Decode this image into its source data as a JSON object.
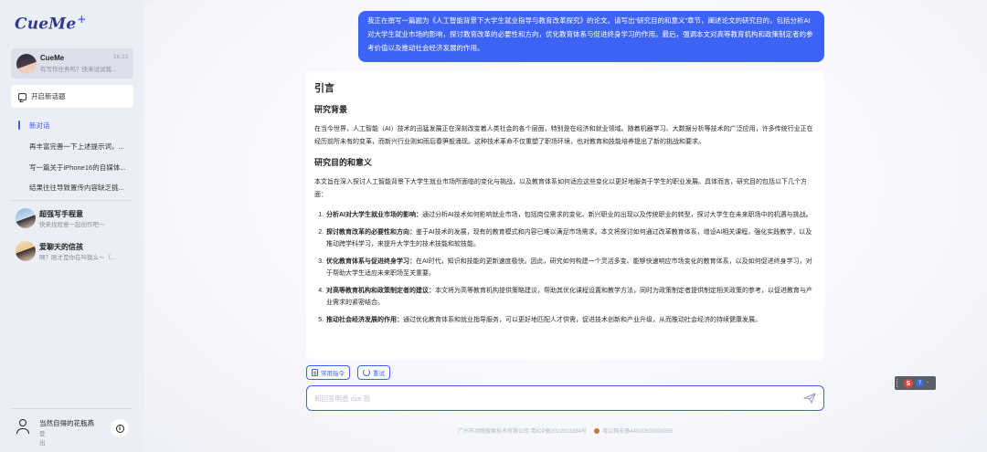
{
  "app": {
    "logo": "CueMe",
    "logo_mark": "+"
  },
  "sidebar": {
    "bot": {
      "name": "CueMe",
      "preview": "有写作任务吗？快来试试我...",
      "time": "16:22"
    },
    "new_chat_label": "开启新话题",
    "history": [
      {
        "label": "新对话",
        "active": true
      },
      {
        "label": "再丰富完善一下上述提示词，..."
      },
      {
        "label": "写一篇关于iPhone16的自媒体..."
      },
      {
        "label": "结果往往导致置传内容缺乏挑..."
      }
    ],
    "agents": [
      {
        "name": "超强写手程意",
        "preview": "快来找程意一起创作吧～"
      },
      {
        "name": "爱聊天的信孩",
        "preview": "嘀？刚才是你在叫我么～（..."
      }
    ],
    "user": {
      "name": "当然自得的花瓶燕",
      "logout": "登出"
    }
  },
  "chat": {
    "user_message": "我正在撰写一篇题为《人工智能背景下大学生就业指导与教育改革探究》的论文。请写出“研究目的和意义”章节，阐述论文的研究目的，包括分析AI对大学生就业市场的影响，探讨教育改革的必要性和方向，优化教育体系与促进终身学习的作用。最后，强调本文对高等教育机构和政策制定者的参考价值以及推动社会经济发展的作用。",
    "answer": {
      "h1": "引言",
      "h2_background": "研究背景",
      "p_background": "在当今世界，人工智能（AI）技术的迅猛发展正在深刻改变着人类社会的各个层面，特别是在经济和就业领域。随着机器学习、大数据分析等技术的广泛应用，许多传统行业正在经历前所未有的变革，而新兴行业则如雨后春笋般涌现。这种技术革命不仅重塑了职场环境，也对教育和技能培养提出了新的挑战和要求。",
      "h2_purpose": "研究目的和意义",
      "p_purpose": "本文旨在深入探讨人工智能背景下大学生就业市场所面临的变化与挑战，以及教育体系如何适应这些变化以更好地服务于学生的职业发展。具体而言，研究目的包括以下几个方面：",
      "items": [
        {
          "title": "分析AI对大学生就业市场的影响：",
          "text": "通过分析AI技术如何影响就业市场，包括岗位需求的变化、新兴职业的出现以及传统职业的转型，探讨大学生在未来职场中的机遇与挑战。"
        },
        {
          "title": "探讨教育改革的必要性和方向：",
          "text": "鉴于AI技术的发展，现有的教育模式和内容已难以满足市场需求。本文将探讨如何通过改革教育体系，增设AI相关课程，强化实践教学，以及推动跨学科学习，来提升大学生的技术技能和软技能。"
        },
        {
          "title": "优化教育体系与促进终身学习：",
          "text": "在AI时代，知识和技能的更新速度极快。因此，研究如何构建一个灵活多变、能够快速响应市场变化的教育体系，以及如何促进终身学习，对于帮助大学生适应未来职场至关重要。"
        },
        {
          "title": "对高等教育机构和政策制定者的建议：",
          "text": "本文将为高等教育机构提供策略建议，帮助其优化课程设置和教学方法，同时为政策制定者提供制定相关政策的参考，以促进教育与产业需求的紧密结合。"
        },
        {
          "title": "推动社会经济发展的作用：",
          "text": "通过优化教育体系和就业指导服务，可以更好地匹配人才供需，促进技术创新和产业升级，从而推动社会经济的持续健康发展。"
        }
      ]
    },
    "chips": {
      "prompt": "常用指令",
      "retry": "重试"
    },
    "input": {
      "placeholder": "和回答明悉 cue 我",
      "value": ""
    },
    "footer": {
      "company": "广州市动物搜索技术有限公司 粤ICP备2022013384号",
      "police": "粤公网安备44010502000055"
    }
  },
  "ime": {
    "mode": "S",
    "label1": "?",
    "label2": "·"
  },
  "colors": {
    "accent": "#3d63f5",
    "sidebar_bg": "#eceef5",
    "bubble": "#3d63f5"
  }
}
